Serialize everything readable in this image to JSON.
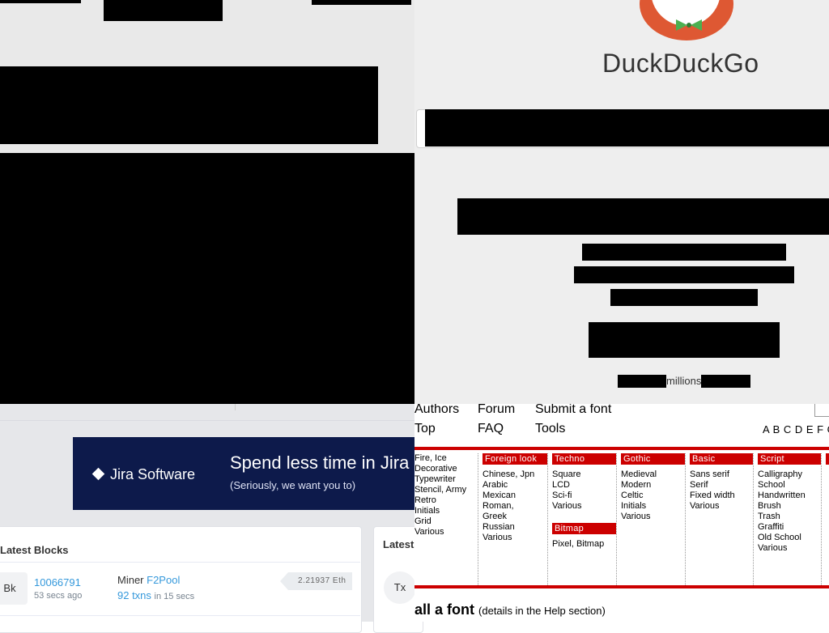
{
  "ddg": {
    "brand": "DuckDuckGo",
    "stats_word": "millions"
  },
  "explorer": {
    "banner": {
      "logo_text": "Jira Software",
      "headline": "Spend less time in Jira",
      "subline": "(Seriously, we want you to)"
    },
    "latest_blocks_title": "Latest Blocks",
    "latest_tx_title": "Latest",
    "block": {
      "badge": "Bk",
      "number": "10066791",
      "age": "53 secs ago",
      "miner_prefix": "Miner",
      "miner_name": "F2Pool",
      "txns": "92 txns",
      "txns_time": "in 15 secs",
      "reward": "2.21937 Eth"
    },
    "tx_badge": "Tx"
  },
  "fontsite": {
    "nav": {
      "authors": "Authors",
      "forum": "Forum",
      "submit": "Submit a font",
      "top": "Top",
      "faq": "FAQ",
      "tools": "Tools"
    },
    "alphabet": "A B C D E F G",
    "col_themes": [
      "Fire, Ice",
      "Decorative",
      "Typewriter",
      "Stencil, Army",
      "Retro",
      "Initials",
      "Grid",
      "Various"
    ],
    "foreign": {
      "header": "Foreign look",
      "items": [
        "Chinese, Jpn",
        "Arabic",
        "Mexican",
        "Roman,",
        "Greek",
        "Russian",
        "Various"
      ]
    },
    "techno": {
      "header": "Techno",
      "items": [
        "Square",
        "LCD",
        "Sci-fi",
        "Various"
      ]
    },
    "bitmap": {
      "header": "Bitmap",
      "items": [
        "Pixel, Bitmap"
      ]
    },
    "gothic": {
      "header": "Gothic",
      "items": [
        "Medieval",
        "Modern",
        "Celtic",
        "Initials",
        "Various"
      ]
    },
    "basic": {
      "header": "Basic",
      "items": [
        "Sans serif",
        "Serif",
        "Fixed width",
        "Various"
      ]
    },
    "script": {
      "header": "Script",
      "items": [
        "Calligraphy",
        "School",
        "Handwritten",
        "Brush",
        "Trash",
        "Graffiti",
        "Old School",
        "Various"
      ]
    },
    "all_fonts": {
      "title": "all a font",
      "details_pre": "(details in the ",
      "details_link": "Help",
      "details_post": " section)"
    }
  }
}
